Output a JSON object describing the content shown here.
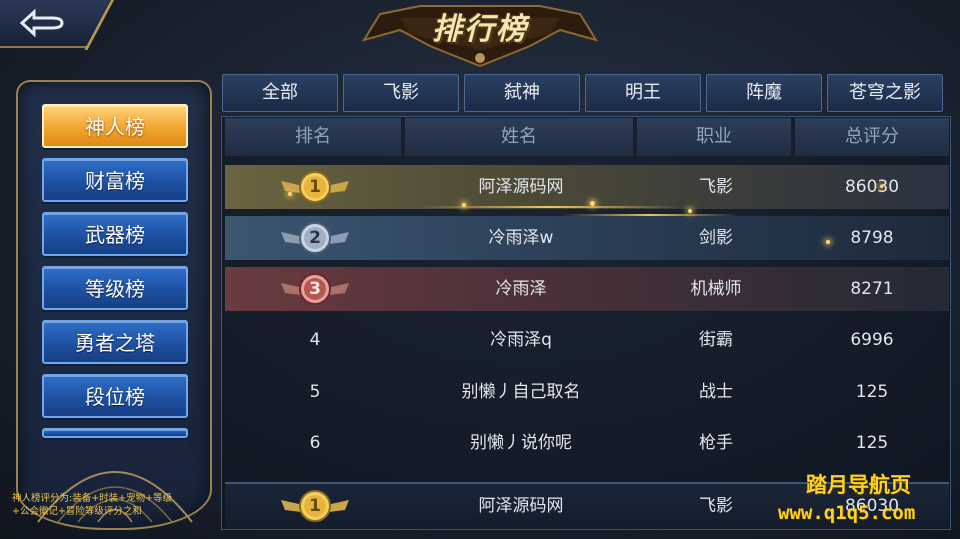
{
  "header": {
    "title": "排行榜",
    "back_icon": "back-arrow-icon"
  },
  "sidebar": {
    "items": [
      {
        "label": "神人榜",
        "active": true
      },
      {
        "label": "财富榜",
        "active": false
      },
      {
        "label": "武器榜",
        "active": false
      },
      {
        "label": "等级榜",
        "active": false
      },
      {
        "label": "勇者之塔",
        "active": false
      },
      {
        "label": "段位榜",
        "active": false
      }
    ],
    "note_line1": "神人榜评分为:装备+时装+宠物+等级",
    "note_line2": "+公会徽记+冒险等级评分之和"
  },
  "tabs": [
    "全部",
    "飞影",
    "弑神",
    "明王",
    "阵魔",
    "苍穹之影"
  ],
  "table": {
    "headers": {
      "rank": "排名",
      "name": "姓名",
      "job": "职业",
      "score": "总评分"
    },
    "rows": [
      {
        "rank": "1",
        "name": "阿泽源码网",
        "job": "飞影",
        "score": "86030"
      },
      {
        "rank": "2",
        "name": "冷雨泽w",
        "job": "剑影",
        "score": "8798"
      },
      {
        "rank": "3",
        "name": "冷雨泽",
        "job": "机械师",
        "score": "8271"
      },
      {
        "rank": "4",
        "name": "冷雨泽q",
        "job": "街霸",
        "score": "6996"
      },
      {
        "rank": "5",
        "name": "别懒丿自己取名",
        "job": "战士",
        "score": "125"
      },
      {
        "rank": "6",
        "name": "别懒丿说你呢",
        "job": "枪手",
        "score": "125"
      }
    ],
    "my_row": {
      "rank": "1",
      "name": "阿泽源码网",
      "job": "飞影",
      "score": "86030"
    }
  },
  "watermark": {
    "line1": "踏月导航页",
    "line2": "www.q1q5.com"
  },
  "colors": {
    "gold_medal": "#e0b64a",
    "silver_medal": "#9fb0c4",
    "bronze_medal": "#b5584f",
    "active_tab": "#f2a531",
    "button_blue": "#2f6fc9",
    "watermark": "#ffd21c"
  }
}
